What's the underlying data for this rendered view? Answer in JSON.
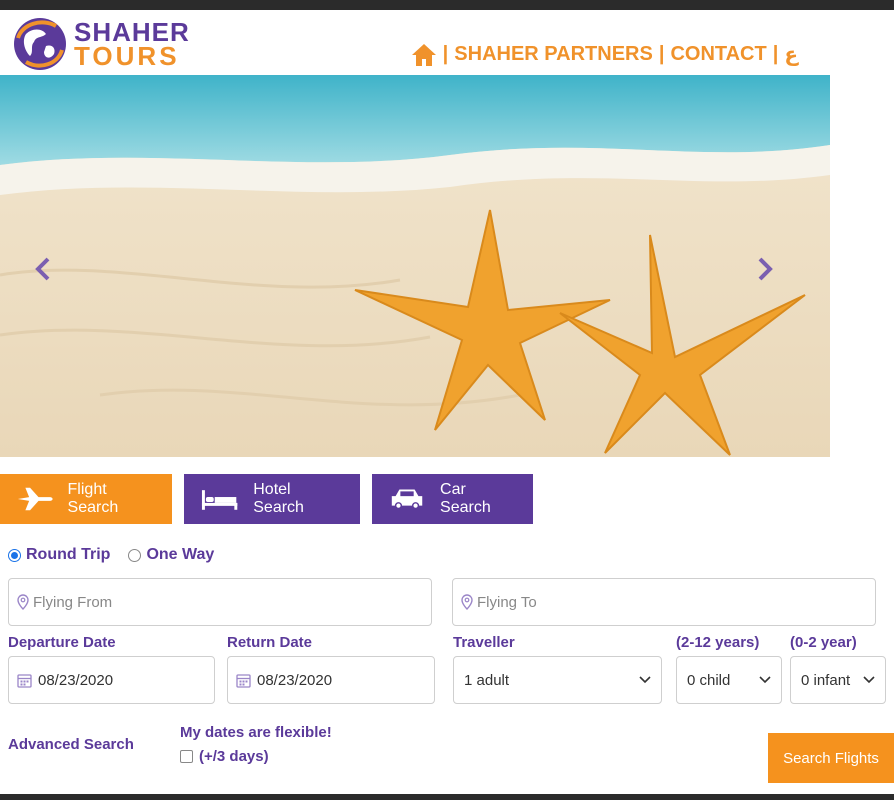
{
  "header": {
    "logo_line1": "SHAHER",
    "logo_line2": "TOURS",
    "nav": [
      "SHAHER PARTNERS",
      "CONTACT",
      "ع"
    ],
    "separator": "|"
  },
  "colors": {
    "purple": "#5b3a9a",
    "orange": "#f5921e"
  },
  "hero": {
    "prev_icon": "chevron-left-icon",
    "next_icon": "chevron-right-icon"
  },
  "tabs": [
    {
      "label": "Flight Search",
      "icon": "airplane-icon",
      "active": true
    },
    {
      "label": "Hotel Search",
      "icon": "bed-icon",
      "active": false
    },
    {
      "label": "Car Search",
      "icon": "car-icon",
      "active": false
    }
  ],
  "trip_type": {
    "round_trip": "Round Trip",
    "one_way": "One Way",
    "selected": "Round Trip"
  },
  "form": {
    "flying_from_placeholder": "Flying From",
    "flying_to_placeholder": "Flying To",
    "departure_label": "Departure Date",
    "return_label": "Return Date",
    "traveller_label": "Traveller",
    "child_label": "(2-12 years)",
    "infant_label": "(0-2 year)",
    "departure_value": "08/23/2020",
    "return_value": "08/23/2020",
    "traveller_value": "1 adult",
    "child_value": "0 child",
    "infant_value": "0 infant",
    "advanced_search": "Advanced Search",
    "flexible_title": "My dates are flexible!",
    "flexible_option": "(+/3 days)",
    "search_button": "Search Flights"
  }
}
